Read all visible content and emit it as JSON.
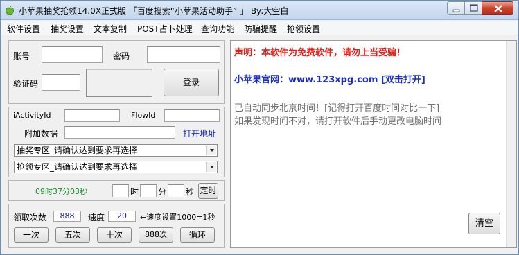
{
  "window": {
    "title": "小苹果抽奖抢领14.0X正式版 「百度搜索“小苹果活动助手” 」 By:大空白"
  },
  "menu": [
    "软件设置",
    "抽奖设置",
    "文本复制",
    "POST占卜处理",
    "查询功能",
    "防骗提醒",
    "抢领设置"
  ],
  "login": {
    "account_label": "账号",
    "account_value": "",
    "password_label": "密码",
    "password_value": "",
    "captcha_label": "验证码",
    "captcha_value": "",
    "login_button": "登录"
  },
  "params": {
    "activity_label": "iActivityId",
    "activity_value": "",
    "flow_label": "iFlowId",
    "flow_value": "",
    "extra_label": "附加数据",
    "extra_value": "",
    "open_link": "打开地址",
    "lottery_select": "抽奖专区_请确认达到要求再选择",
    "claim_select": "抢领专区_请确认达到要求再选择"
  },
  "timer": {
    "clock": "09时37分03秒",
    "hour_unit": "时",
    "minute_unit": "分",
    "second_unit": "秒",
    "timer_button": "定时"
  },
  "run": {
    "count_label": "领取次数",
    "count_value": "888",
    "speed_label": "速度",
    "speed_value": "20",
    "speed_hint": "←速度设置1000=1秒",
    "buttons": [
      "一次",
      "五次",
      "十次",
      "888次",
      "循环"
    ]
  },
  "output": {
    "line1": "声明：本软件为免费软件，请勿上当受骗！",
    "line2": "小苹果官网：www.123xpg.com [双击打开]",
    "line3": "已自动同步北京时间！[记得打开百度时间对比一下]",
    "line4": "如果发现时间不对，请打开软件后手动更改电脑时间",
    "clear_button": "清空"
  },
  "colors": {
    "warning": "#e0201a",
    "link": "#1c2fc0",
    "info": "#707070",
    "clock": "#1f8a2e"
  },
  "icons": {
    "app": "apple-icon",
    "minimize": "minimize-icon",
    "maximize": "maximize-icon",
    "close": "close-icon"
  }
}
